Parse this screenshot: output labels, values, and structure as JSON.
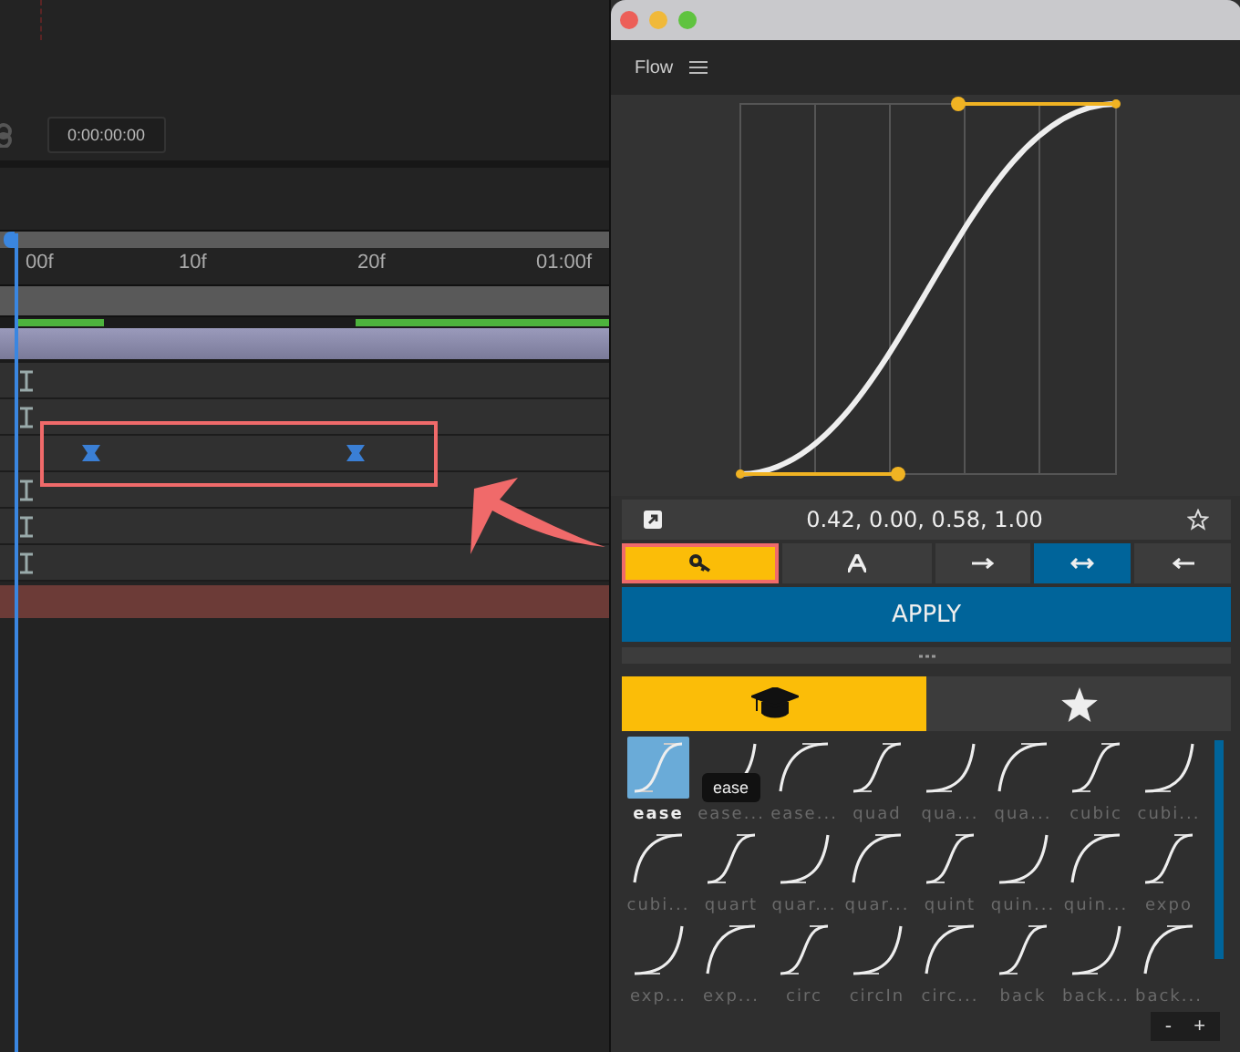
{
  "timeline": {
    "timecode": "0:00:00:00",
    "ruler_labels": [
      "00f",
      "10f",
      "20f",
      "01:00f"
    ],
    "tracks": [
      {
        "kind": "marker"
      },
      {
        "kind": "marker"
      },
      {
        "kind": "keyframes"
      },
      {
        "kind": "marker"
      },
      {
        "kind": "marker"
      },
      {
        "kind": "marker"
      }
    ]
  },
  "panel": {
    "title": "Flow",
    "curve_values": "0.42, 0.00, 0.58, 1.00",
    "modes": [
      {
        "kind": "key",
        "selected": true
      },
      {
        "kind": "text",
        "selected": false
      },
      {
        "kind": "out",
        "selected": false
      },
      {
        "kind": "inout",
        "selected": true
      },
      {
        "kind": "in",
        "selected": false
      }
    ],
    "apply": "APPLY",
    "tabs": [
      {
        "kind": "library",
        "selected": true
      },
      {
        "kind": "favorites",
        "selected": false
      }
    ],
    "presets": [
      {
        "label": "ease",
        "selected": true
      },
      {
        "label": "ease...",
        "selected": false
      },
      {
        "label": "ease...",
        "selected": false
      },
      {
        "label": "quad",
        "selected": false
      },
      {
        "label": "qua...",
        "selected": false
      },
      {
        "label": "qua...",
        "selected": false
      },
      {
        "label": "cubic",
        "selected": false
      },
      {
        "label": "cubi...",
        "selected": false
      },
      {
        "label": "cubi...",
        "selected": false
      },
      {
        "label": "quart",
        "selected": false
      },
      {
        "label": "quar...",
        "selected": false
      },
      {
        "label": "quar...",
        "selected": false
      },
      {
        "label": "quint",
        "selected": false
      },
      {
        "label": "quin...",
        "selected": false
      },
      {
        "label": "quin...",
        "selected": false
      },
      {
        "label": "expo",
        "selected": false
      },
      {
        "label": "exp...",
        "selected": false
      },
      {
        "label": "exp...",
        "selected": false
      },
      {
        "label": "circ",
        "selected": false
      },
      {
        "label": "circIn",
        "selected": false
      },
      {
        "label": "circ...",
        "selected": false
      },
      {
        "label": "back",
        "selected": false
      },
      {
        "label": "back...",
        "selected": false
      },
      {
        "label": "back...",
        "selected": false
      }
    ],
    "tooltip": "ease",
    "zoom_controls": [
      "-",
      "+"
    ]
  }
}
